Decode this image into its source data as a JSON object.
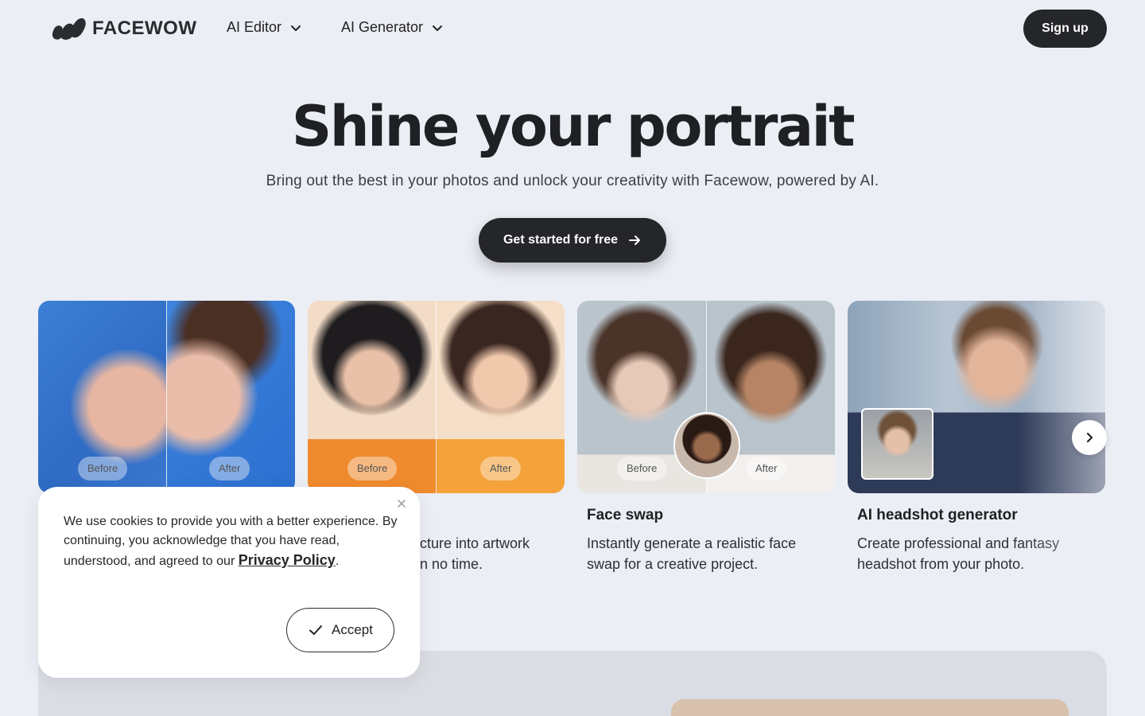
{
  "brand": {
    "name": "FACEWOW"
  },
  "nav": {
    "items": [
      {
        "label": "AI Editor",
        "icon": "chevron-down-icon"
      },
      {
        "label": "AI Generator",
        "icon": "chevron-down-icon"
      }
    ],
    "signup_label": "Sign up"
  },
  "hero": {
    "title": "Shine your portrait",
    "subtitle": "Bring out the best in your photos and unlock your creativity with Facewow, powered by AI.",
    "cta_label": "Get started for free",
    "cta_icon": "arrow-right-icon"
  },
  "cards": [
    {
      "before_label": "Before",
      "after_label": "After",
      "title": "",
      "description": ""
    },
    {
      "before_label": "Before",
      "after_label": "After",
      "title": "",
      "description_line1": "cture into artwork",
      "description_line2": "n no time."
    },
    {
      "before_label": "Before",
      "after_label": "After",
      "title": "Face swap",
      "description": "Instantly generate a realistic face swap for a creative project."
    },
    {
      "title": "AI headshot generator",
      "description": "Create professional and fantasy headshot from your photo."
    }
  ],
  "carousel": {
    "next_icon": "chevron-right-icon"
  },
  "cookie": {
    "text": "We use cookies to provide you with a better experience. By continuing, you acknowledge that you have read, understood, and agreed to our",
    "link_label": "Privacy Policy",
    "period": ".",
    "accept_label": "Accept",
    "accept_icon": "check-icon",
    "close_icon": "close-icon"
  },
  "colors": {
    "background": "#eceef5",
    "primary_button": "#25262a",
    "text": "#1f2023"
  }
}
